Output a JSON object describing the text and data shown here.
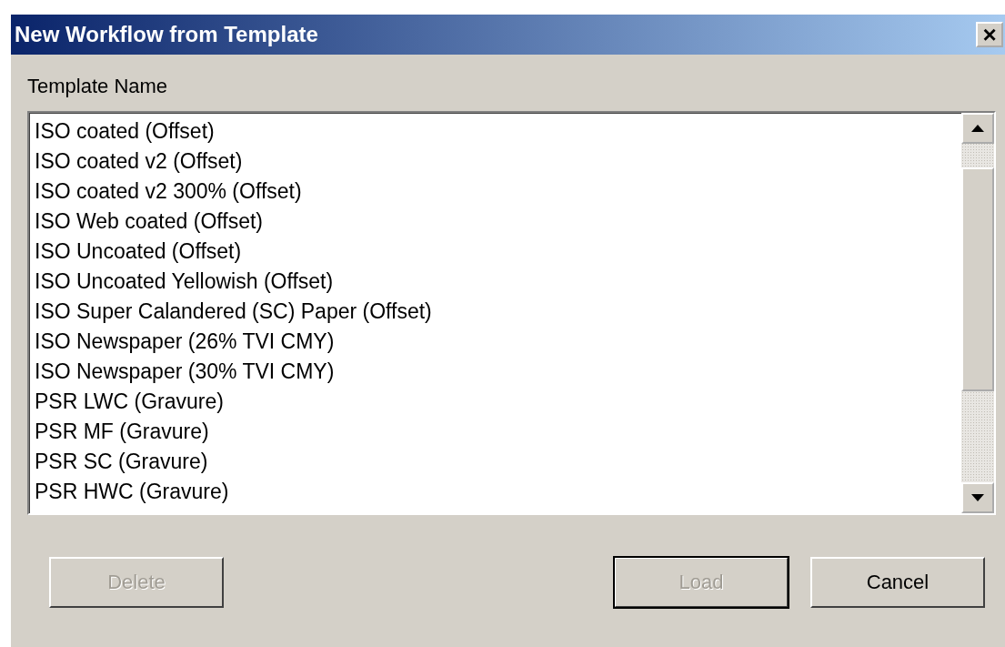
{
  "window": {
    "title": "New Workflow from Template",
    "close": "×"
  },
  "list_label": "Template Name",
  "templates": [
    {
      "name": "ISO coated (Offset)"
    },
    {
      "name": "ISO coated v2 (Offset)"
    },
    {
      "name": "ISO coated v2 300% (Offset)"
    },
    {
      "name": "ISO Web coated (Offset)"
    },
    {
      "name": "ISO Uncoated (Offset)"
    },
    {
      "name": "ISO Uncoated Yellowish (Offset)"
    },
    {
      "name": "ISO Super Calandered (SC) Paper (Offset)"
    },
    {
      "name": "ISO Newspaper (26% TVI CMY)"
    },
    {
      "name": "ISO Newspaper (30% TVI CMY)"
    },
    {
      "name": "PSR LWC (Gravure)"
    },
    {
      "name": "PSR MF (Gravure)"
    },
    {
      "name": "PSR SC (Gravure)"
    },
    {
      "name": "PSR HWC (Gravure)"
    }
  ],
  "buttons": [
    {
      "label": "Delete",
      "disabled": true,
      "default": false
    },
    {
      "label": "Load",
      "disabled": true,
      "default": true
    },
    {
      "label": "Cancel",
      "disabled": false,
      "default": false
    }
  ]
}
